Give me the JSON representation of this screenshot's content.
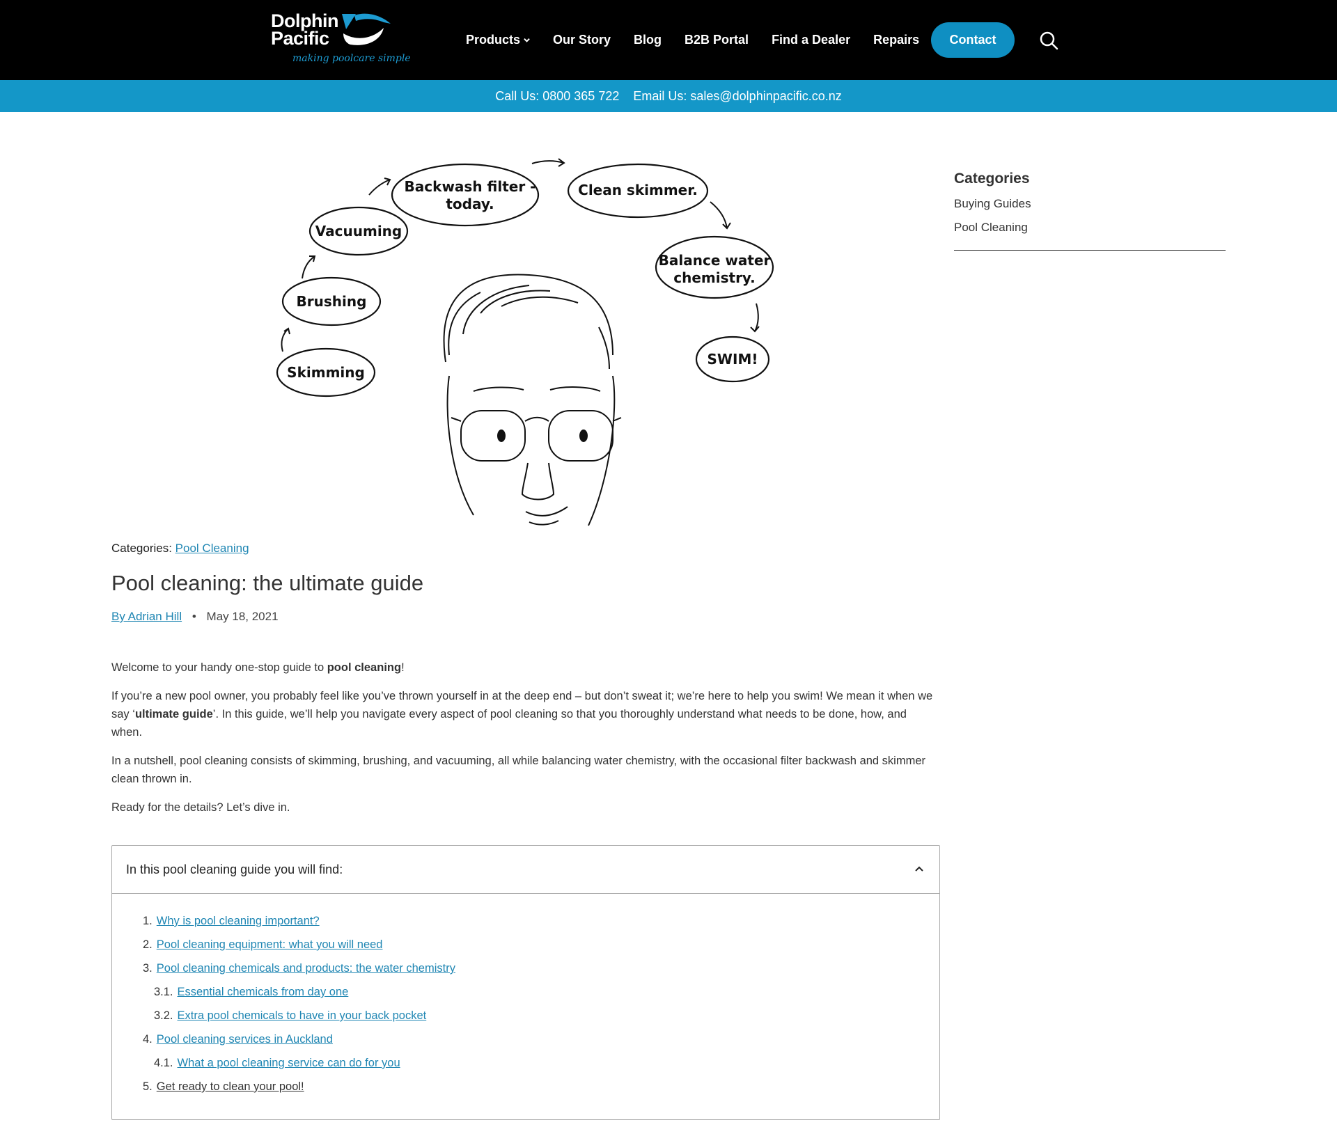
{
  "header": {
    "logo_line1": "Dolphin",
    "logo_line2": "Pacific",
    "logo_tagline": "making poolcare simple",
    "nav": [
      {
        "label": "Products"
      },
      {
        "label": "Our Story"
      },
      {
        "label": "Blog"
      },
      {
        "label": "B2B Portal"
      },
      {
        "label": "Find a Dealer"
      },
      {
        "label": "Repairs"
      }
    ],
    "contact_label": "Contact"
  },
  "infobar": {
    "phone": "Call Us: 0800 365 722",
    "email": "Email Us: sales@dolphinpacific.co.nz"
  },
  "hero": {
    "bubbles": [
      "Skimming",
      "Brushing",
      "Vacuuming",
      "Backwash filter -",
      "today.",
      "Clean skimmer.",
      "Balance water",
      "chemistry.",
      "SWIM!"
    ]
  },
  "sidebar": {
    "title": "Categories",
    "items": [
      "Buying Guides",
      "Pool Cleaning"
    ]
  },
  "article": {
    "categories_label": "Categories:",
    "category": "Pool Cleaning",
    "title": "Pool cleaning: the ultimate guide",
    "author": "By Adrian Hill",
    "date": "May 18, 2021",
    "p1_a": "Welcome to your handy one-stop guide to ",
    "p1_b": "pool cleaning",
    "p1_c": "!",
    "p2_a": "If you’re a new pool owner, you probably feel like you’ve thrown yourself in at the deep end – but don’t sweat it; we’re here to help you swim! We mean it when we say ‘",
    "p2_b": "ultimate guide",
    "p2_c": "’. In this guide, we’ll help you navigate every aspect of pool cleaning so that you thoroughly understand what needs to be done, how, and when.",
    "p3": "In a nutshell, pool cleaning consists of skimming, brushing, and vacuuming, all while balancing water chemistry, with the occasional filter backwash and skimmer clean thrown in.",
    "p4": "Ready for the details? Let’s dive in."
  },
  "toc": {
    "heading": "In this pool cleaning guide you will find:",
    "items": [
      {
        "num": "1.",
        "text": "Why is pool cleaning important?"
      },
      {
        "num": "2.",
        "text": "Pool cleaning equipment: what you will need"
      },
      {
        "num": "3.",
        "text": "Pool cleaning chemicals and products: the water chemistry"
      },
      {
        "num": "3.1.",
        "text": "Essential chemicals from day one"
      },
      {
        "num": "3.2.",
        "text": "Extra pool chemicals to have in your back pocket"
      },
      {
        "num": "4.",
        "text": "Pool cleaning services in Auckland"
      },
      {
        "num": "4.1.",
        "text": "What a pool cleaning service can do for you"
      },
      {
        "num": "5.",
        "text": "Get ready to clean your pool!"
      }
    ]
  }
}
